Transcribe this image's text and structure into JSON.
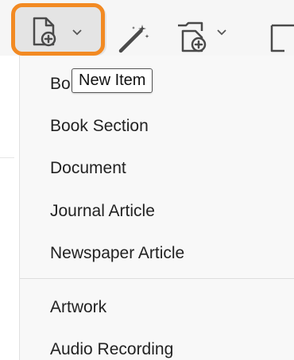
{
  "toolbar": {
    "new_item_icon": "new-item-document-plus-icon",
    "new_item_chevron": "chevron-down-icon",
    "magic_wand_icon": "magic-wand-icon",
    "add_attachment_icon": "add-attachment-icon",
    "attachment_chevron": "chevron-down-icon",
    "partial_icon": "note-icon",
    "highlight_color": "#f28a23"
  },
  "tooltip": {
    "text": "New Item"
  },
  "menu": {
    "items": [
      {
        "label": "Bo"
      },
      {
        "label": "Book Section"
      },
      {
        "label": "Document"
      },
      {
        "label": "Journal Article"
      },
      {
        "label": "Newspaper Article"
      },
      {
        "label": "Artwork"
      },
      {
        "label": "Audio Recording"
      }
    ]
  }
}
